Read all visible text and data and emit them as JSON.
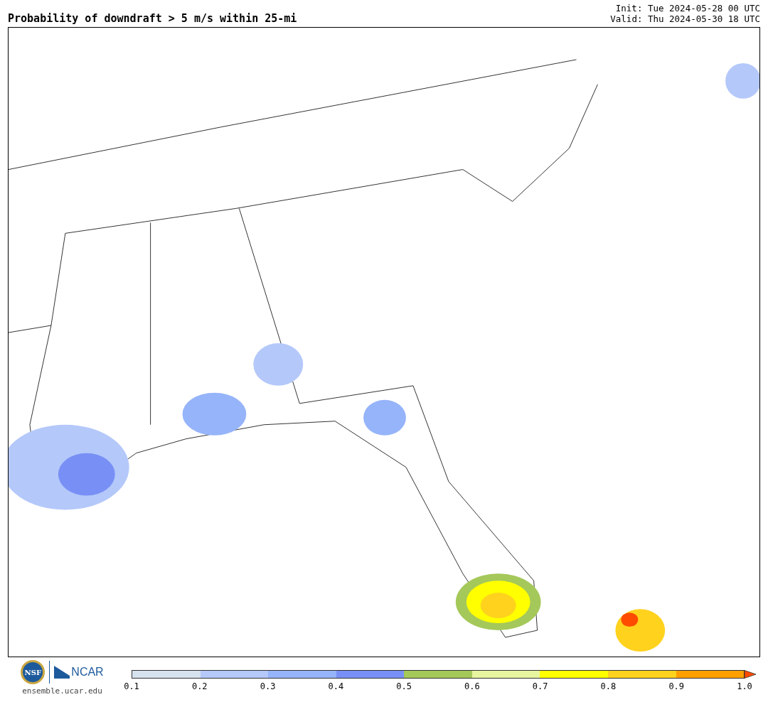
{
  "title": "Probability of downdraft > 5 m/s within 25-mi",
  "init": "Init: Tue 2024-05-28 00 UTC",
  "valid": "Valid: Thu 2024-05-30 18 UTC",
  "logos": {
    "nsf": "NSF",
    "ncar": "NCAR",
    "site": "ensemble.ucar.edu"
  },
  "colorbar": {
    "bins": [
      {
        "color": "#d6e2ee"
      },
      {
        "color": "#b4c8fa"
      },
      {
        "color": "#96b4fa"
      },
      {
        "color": "#7890f5"
      },
      {
        "color": "#a5c85a"
      },
      {
        "color": "#e8f5a0"
      },
      {
        "color": "#ffff00"
      },
      {
        "color": "#ffd21e"
      },
      {
        "color": "#ffa000"
      }
    ],
    "extend": {
      "color": "#ff4b00"
    },
    "ticks": [
      "0.1",
      "0.2",
      "0.3",
      "0.4",
      "0.5",
      "0.6",
      "0.7",
      "0.8",
      "0.9",
      "1.0"
    ]
  }
}
